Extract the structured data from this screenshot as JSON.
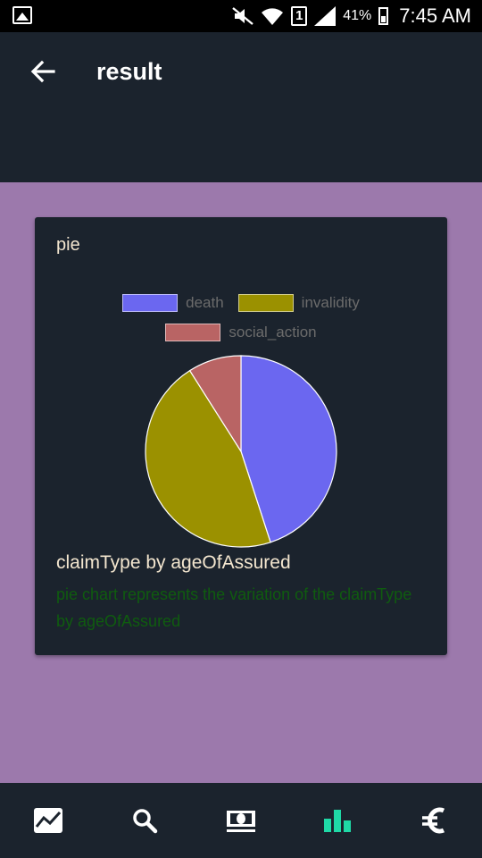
{
  "status_bar": {
    "battery": "41%",
    "time": "7:45 AM",
    "sim_slot": "1"
  },
  "app_bar": {
    "title": "result",
    "back_icon": "arrow-left-icon"
  },
  "card": {
    "title": "pie",
    "caption": "claimType by ageOfAssured",
    "description": "pie chart represents the variation of the claimType by ageOfAssured"
  },
  "chart_data": {
    "type": "pie",
    "title": "",
    "series": [
      {
        "name": "death",
        "value": 45,
        "color": "#6b67f0"
      },
      {
        "name": "invalidity",
        "value": 46,
        "color": "#9b9100"
      },
      {
        "name": "social_action",
        "value": 9,
        "color": "#b96464"
      }
    ],
    "legend": "top"
  },
  "bottom_nav": {
    "items": [
      {
        "icon": "trend-chart-icon",
        "active": false
      },
      {
        "icon": "search-icon",
        "active": false
      },
      {
        "icon": "money-icon",
        "active": false
      },
      {
        "icon": "bar-chart-icon",
        "active": true
      },
      {
        "icon": "euro-icon",
        "active": false
      }
    ],
    "active_color": "#1fd9a6",
    "inactive_color": "#ffffff"
  }
}
